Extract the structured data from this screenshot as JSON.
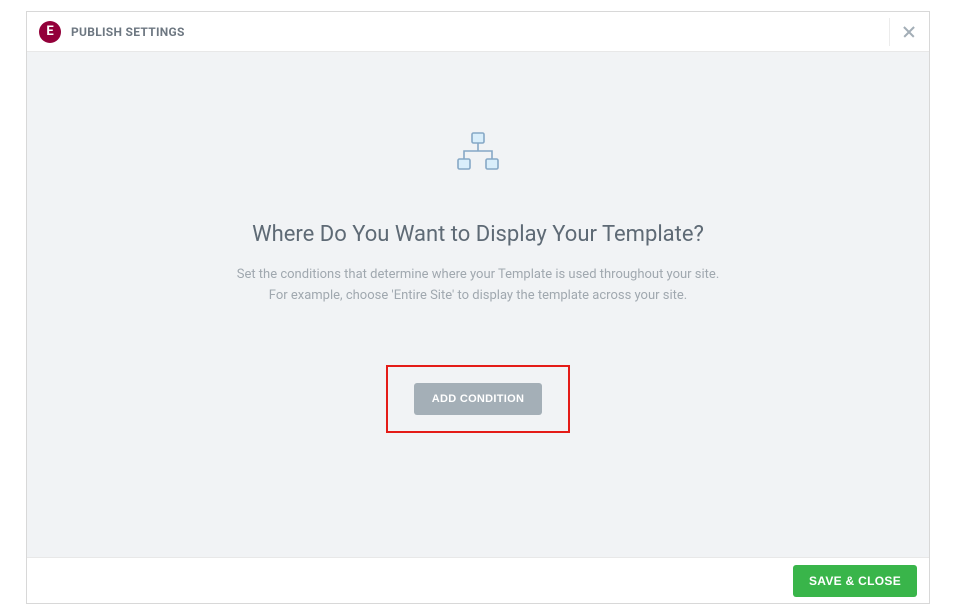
{
  "header": {
    "title": "PUBLISH SETTINGS",
    "logo_letter": "E"
  },
  "body": {
    "heading": "Where Do You Want to Display Your Template?",
    "description_line1": "Set the conditions that determine where your Template is used throughout your site.",
    "description_line2": "For example, choose 'Entire Site' to display the template across your site.",
    "add_condition_label": "ADD CONDITION"
  },
  "footer": {
    "save_close_label": "SAVE & CLOSE"
  },
  "colors": {
    "brand": "#93003a",
    "highlight_border": "#e41b17",
    "primary_action": "#39b54a",
    "muted_button": "#a4afb7"
  }
}
